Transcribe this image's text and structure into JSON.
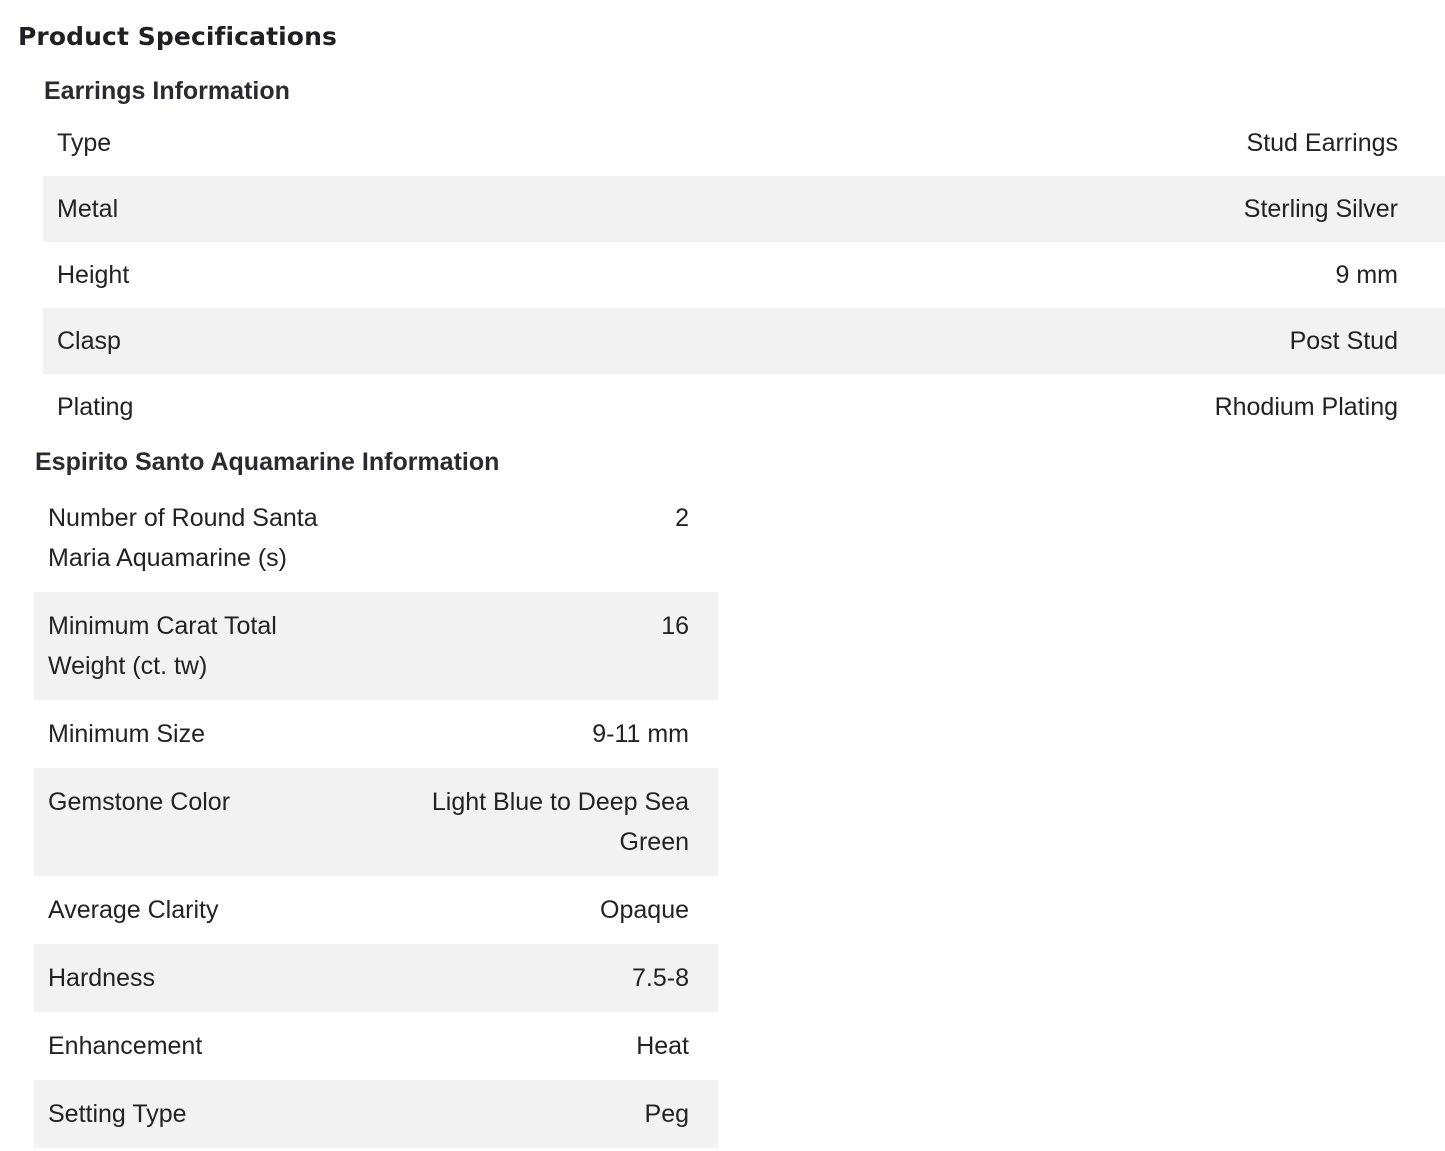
{
  "page": {
    "title": "Product Specifications"
  },
  "earrings": {
    "title": "Earrings Information",
    "rows": [
      {
        "label": "Type",
        "value": "Stud Earrings"
      },
      {
        "label": "Metal",
        "value": "Sterling Silver"
      },
      {
        "label": "Height",
        "value": "9 mm"
      },
      {
        "label": "Clasp",
        "value": "Post Stud"
      },
      {
        "label": "Plating",
        "value": "Rhodium Plating"
      }
    ]
  },
  "gemstone": {
    "title": "Espirito Santo Aquamarine Information",
    "rows": [
      {
        "label": "Number of Round Santa Maria Aquamarine (s)",
        "value": "2"
      },
      {
        "label": "Minimum Carat Total Weight (ct. tw)",
        "value": "16"
      },
      {
        "label": "Minimum Size",
        "value": "9-11 mm"
      },
      {
        "label": "Gemstone Color",
        "value": "Light Blue to Deep Sea Green"
      },
      {
        "label": "Average Clarity",
        "value": "Opaque"
      },
      {
        "label": "Hardness",
        "value": "7.5-8"
      },
      {
        "label": "Enhancement",
        "value": "Heat"
      },
      {
        "label": "Setting Type",
        "value": "Peg"
      }
    ]
  },
  "colors": {
    "row_shade": "#f2f2f2",
    "text": "#222222",
    "heading": "#1f1f24"
  }
}
